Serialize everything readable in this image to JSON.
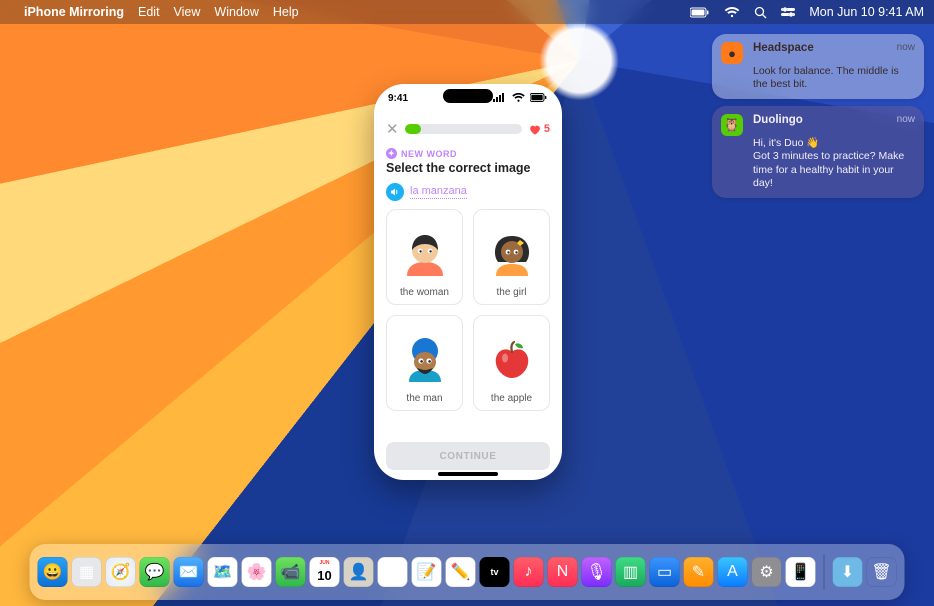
{
  "menubar": {
    "app": "iPhone Mirroring",
    "menus": [
      "Edit",
      "View",
      "Window",
      "Help"
    ],
    "clock": "Mon Jun 10  9:41 AM"
  },
  "notifications": [
    {
      "app": "Headspace",
      "time": "now",
      "title": "Headspace",
      "body": "Look for balance. The middle is the best bit.",
      "icon_color": "#ff7b1a",
      "dark": false
    },
    {
      "app": "Duolingo",
      "time": "now",
      "title": "Duolingo",
      "body": "Hi, it's Duo 👋\nGot 3 minutes to practice? Make time for a healthy habit in your day!",
      "icon_color": "#58cc02",
      "dark": true
    }
  ],
  "phone": {
    "time": "9:41",
    "hearts": "5",
    "badge": "NEW WORD",
    "prompt": "Select the correct image",
    "speak_word": "la manzana",
    "options": [
      {
        "label": "the woman",
        "art": "woman"
      },
      {
        "label": "the girl",
        "art": "girl"
      },
      {
        "label": "the man",
        "art": "man"
      },
      {
        "label": "the apple",
        "art": "apple"
      }
    ],
    "continue": "CONTINUE"
  },
  "dock": {
    "icons": [
      {
        "name": "finder",
        "bg": "linear-gradient(#2aa3f5,#0a6fd6)",
        "glyph": "😀"
      },
      {
        "name": "launchpad",
        "bg": "#e5e7eb",
        "glyph": "▦"
      },
      {
        "name": "safari",
        "bg": "radial-gradient(#fff,#dfe8f2)",
        "glyph": "🧭"
      },
      {
        "name": "messages",
        "bg": "linear-gradient(#6ee25c,#2fb84b)",
        "glyph": "💬"
      },
      {
        "name": "mail",
        "bg": "linear-gradient(#4fb0ff,#1770e6)",
        "glyph": "✉️"
      },
      {
        "name": "maps",
        "bg": "#fff",
        "glyph": "🗺️"
      },
      {
        "name": "photos",
        "bg": "#fff",
        "glyph": "🌸"
      },
      {
        "name": "facetime",
        "bg": "linear-gradient(#6ee25c,#2fb84b)",
        "glyph": "📹"
      },
      {
        "name": "calendar",
        "bg": "#fff",
        "glyph": "10"
      },
      {
        "name": "contacts",
        "bg": "#d7d2c6",
        "glyph": "👤"
      },
      {
        "name": "reminders",
        "bg": "#fff",
        "glyph": "☰"
      },
      {
        "name": "notes",
        "bg": "#fff",
        "glyph": "📝"
      },
      {
        "name": "freeform",
        "bg": "#fff",
        "glyph": "✏️"
      },
      {
        "name": "tv",
        "bg": "#000",
        "glyph": "tv"
      },
      {
        "name": "music",
        "bg": "linear-gradient(#ff5d6a,#ff2d55)",
        "glyph": "♪"
      },
      {
        "name": "news",
        "bg": "linear-gradient(#ff5d6a,#ff2d55)",
        "glyph": "N"
      },
      {
        "name": "podcasts",
        "bg": "linear-gradient(#c063ff,#7d2bff)",
        "glyph": "🎙"
      },
      {
        "name": "numbers",
        "bg": "linear-gradient(#3ddc84,#19a95c)",
        "glyph": "▥"
      },
      {
        "name": "keynote",
        "bg": "linear-gradient(#3a95ff,#0a62d6)",
        "glyph": "▭"
      },
      {
        "name": "pages",
        "bg": "linear-gradient(#ffb02e,#ff8c00)",
        "glyph": "✎"
      },
      {
        "name": "appstore",
        "bg": "linear-gradient(#3ac4ff,#0a7bff)",
        "glyph": "A"
      },
      {
        "name": "settings",
        "bg": "#8e8e93",
        "glyph": "⚙"
      },
      {
        "name": "mirroring",
        "bg": "#fff",
        "glyph": "📱"
      }
    ],
    "right": [
      {
        "name": "downloads",
        "bg": "#6fb9e6",
        "glyph": "⬇"
      },
      {
        "name": "trash",
        "bg": "transparent",
        "glyph": "🗑"
      }
    ]
  }
}
